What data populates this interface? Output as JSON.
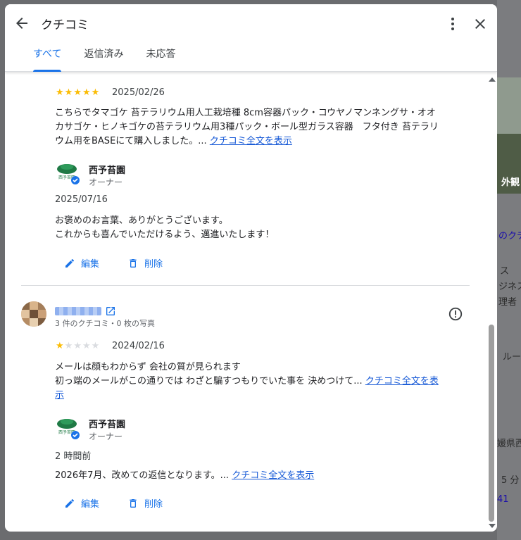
{
  "background": {
    "right_texts": [
      "外観",
      "のクチ",
      "ス",
      "ジネス",
      "理者",
      "ルー",
      "媛県西",
      "5 分",
      "41"
    ]
  },
  "dialog": {
    "title": "クチコミ",
    "tabs": [
      {
        "label": "すべて",
        "active": true
      },
      {
        "label": "返信済み",
        "active": false
      },
      {
        "label": "未応答",
        "active": false
      }
    ]
  },
  "reviews": [
    {
      "rating": 5,
      "date": "2025/02/26",
      "text_lines": [
        "こちらでタマゴケ 苔テラリウム用人工栽培種 8cm容器パック・コウヤノマンネングサ・オオ",
        "カサゴケ・ヒノキゴケの苔テラリウム用3種パック・ボール型ガラス容器　フタ付き 苔テラリ",
        "ウム用をBASEにて購入しました。..."
      ],
      "more_link": "クチコミ全文を表示",
      "reply": {
        "owner_name": "西予苔園",
        "owner_role": "オーナー",
        "date": "2025/07/16",
        "text_lines": [
          "お褒めのお言葉、ありがとうございます。",
          "これからも喜んでいただけるよう、邁進いたします！"
        ],
        "more_link": ""
      },
      "actions": {
        "edit": "編集",
        "delete": "削除"
      }
    },
    {
      "reviewer_meta": "3 件のクチコミ・0 枚の写真",
      "rating": 1,
      "date": "2024/02/16",
      "text_lines": [
        "メールは顔もわからず 会社の質が見られます",
        "初っ端のメールがこの通りでは わざと騙すつもりでいた事を 決めつけて..."
      ],
      "more_link_part1": "クチコミ全文を表",
      "more_link_part2": "示",
      "reply": {
        "owner_name": "西予苔園",
        "owner_role": "オーナー",
        "date": "2 時間前",
        "text": "2026年7月、改めての返信となります。...",
        "more_link": "クチコミ全文を表示"
      },
      "actions": {
        "edit": "編集",
        "delete": "削除"
      }
    }
  ],
  "colors": {
    "accent": "#1a73e8",
    "star": "#fbbc04",
    "link": "#1558d6"
  }
}
